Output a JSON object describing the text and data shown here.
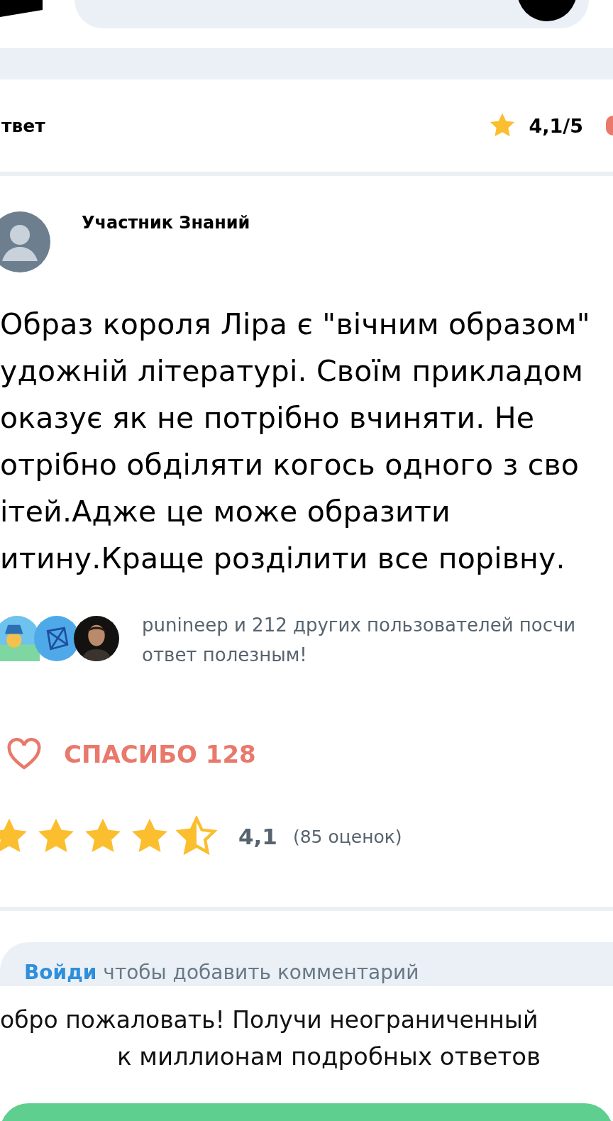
{
  "answer_header": {
    "title": "твет",
    "rating": "4,1/5"
  },
  "author": {
    "name": "Участник Знаний"
  },
  "answer_text": "Образ короля Ліра є \"вічним образом\"\nудожній літературі. Своїм прикладом\nоказує як не потрібно вчиняти. Не\nотрібно обділяти когось одного з сво\nітей.Адже це може образити\nитину.Краще розділити все порівну.",
  "voters": {
    "avatars": [
      {
        "kind": "bird"
      },
      {
        "kind": "network"
      },
      {
        "kind": "picture"
      }
    ],
    "text": "punineep и 212 других пользователей посчи\nответ полезным!"
  },
  "thanks": {
    "label": "СПАСИБО 128"
  },
  "rating": {
    "stars": 4.5,
    "score": "4,1",
    "count": "(85 оценок)"
  },
  "comment": {
    "link": "Войди",
    "text": " чтобы добавить комментарий"
  },
  "banner": {
    "line_1": "обро пожаловать! Получи неограниченный",
    "line_2": "к миллионам подробных ответов"
  }
}
